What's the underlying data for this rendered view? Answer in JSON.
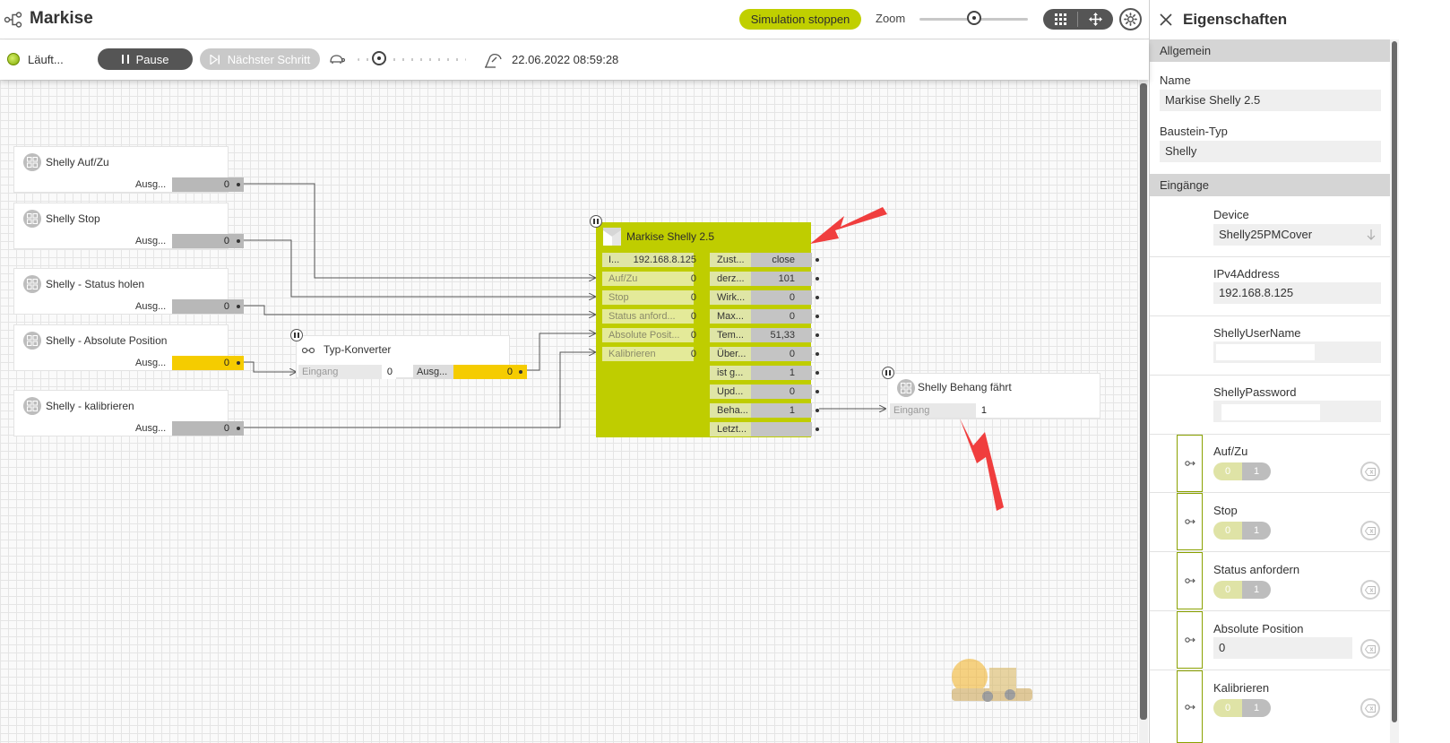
{
  "header": {
    "title": "Markise",
    "sim_stop_label": "Simulation stoppen",
    "zoom_label": "Zoom",
    "zoom_level": 0.5
  },
  "toolbar": {
    "status": "Läuft...",
    "pause_label": "Pause",
    "next_step_label": "Nächster Schritt",
    "speed_level": 0.2,
    "datetime": "22.06.2022 08:59:28"
  },
  "nodes": {
    "auf_zu": {
      "title": "Shelly Auf/Zu",
      "port": "Ausg...",
      "value": "0"
    },
    "stop": {
      "title": "Shelly Stop",
      "port": "Ausg...",
      "value": "0"
    },
    "status_holen": {
      "title": "Shelly - Status holen",
      "port": "Ausg...",
      "value": "0"
    },
    "absolute_position": {
      "title": "Shelly - Absolute Position",
      "port": "Ausg...",
      "value": "0"
    },
    "kalibrieren": {
      "title": "Shelly - kalibrieren",
      "port": "Ausg...",
      "value": "0"
    },
    "typ_konverter": {
      "title": "Typ-Konverter",
      "input_label": "Eingang",
      "input_value": "0",
      "output_label": "Ausg...",
      "output_value": "0"
    },
    "behang": {
      "title": "Shelly Behang fährt",
      "input_label": "Eingang",
      "input_value": "1"
    },
    "markise": {
      "title": "Markise Shelly 2.5",
      "inputs": [
        {
          "label": "I...",
          "value": "192.168.8.125"
        },
        {
          "label": "Auf/Zu",
          "value": "0"
        },
        {
          "label": "Stop",
          "value": "0"
        },
        {
          "label": "Status anford...",
          "value": "0"
        },
        {
          "label": "Absolute Posit...",
          "value": "0"
        },
        {
          "label": "Kalibrieren",
          "value": "0"
        }
      ],
      "outputs": [
        {
          "label": "Zust...",
          "value": "close"
        },
        {
          "label": "derz...",
          "value": "101"
        },
        {
          "label": "Wirk...",
          "value": "0"
        },
        {
          "label": "Max...",
          "value": "0"
        },
        {
          "label": "Tem...",
          "value": "51,33"
        },
        {
          "label": "Über...",
          "value": "0"
        },
        {
          "label": "ist g...",
          "value": "1"
        },
        {
          "label": "Upd...",
          "value": "0"
        },
        {
          "label": "Beha...",
          "value": "1"
        },
        {
          "label": "Letzt...",
          "value": ""
        }
      ]
    }
  },
  "panel": {
    "title": "Eigenschaften",
    "section_general": "Allgemein",
    "name_label": "Name",
    "name_value": "Markise Shelly 2.5",
    "type_label": "Baustein-Typ",
    "type_value": "Shelly",
    "section_inputs": "Eingänge",
    "device_label": "Device",
    "device_value": "Shelly25PMCover",
    "ipv4_label": "IPv4Address",
    "ipv4_value": "192.168.8.125",
    "username_label": "ShellyUserName",
    "password_label": "ShellyPassword",
    "toggle_inputs": [
      {
        "label": "Auf/Zu",
        "off": "0",
        "on": "1"
      },
      {
        "label": "Stop",
        "off": "0",
        "on": "1"
      },
      {
        "label": "Status anfordern",
        "off": "0",
        "on": "1"
      }
    ],
    "abs_pos_label": "Absolute Position",
    "abs_pos_value": "0",
    "kalibrieren_label": "Kalibrieren",
    "kalibrieren_off": "0",
    "kalibrieren_on": "1"
  },
  "colors": {
    "accent": "#c0cf00",
    "block": "#bfcd00",
    "highlight": "#f5cc00",
    "arrow": "#f03e3e"
  }
}
